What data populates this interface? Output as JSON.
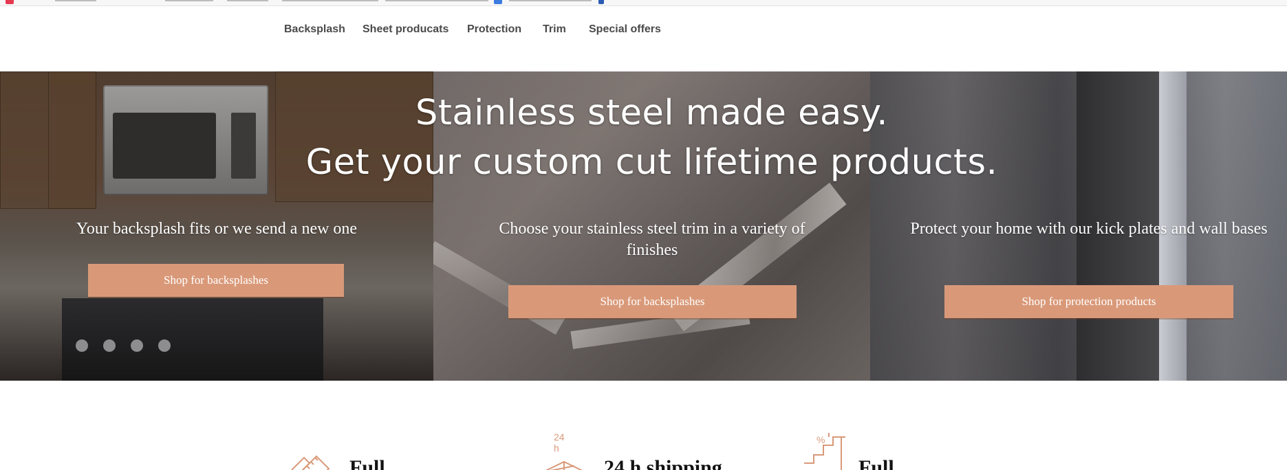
{
  "nav": {
    "items": [
      {
        "label": "Backsplash"
      },
      {
        "label": "Sheet producats"
      },
      {
        "label": "Protection"
      },
      {
        "label": "Trim"
      },
      {
        "label": "Special offers"
      }
    ]
  },
  "hero": {
    "title_line1": "Stainless steel made easy.",
    "title_line2": "Get your custom cut lifetime products.",
    "columns": [
      {
        "text": "Your backsplash fits or we send a new one",
        "button": "Shop for backsplashes"
      },
      {
        "text": "Choose your stainless steel trim in a variety of finishes",
        "button": "Shop for backsplashes"
      },
      {
        "text": "Protect your home with our kick plates and wall bases",
        "button": "Shop for protection products"
      }
    ],
    "button_color": "#d99979"
  },
  "features": [
    {
      "icon": "ruler-pencil-icon",
      "title": "Full"
    },
    {
      "icon": "24h-shipping-box-icon",
      "icon_label": "24 h",
      "title": "24 h shipping"
    },
    {
      "icon": "discount-stairs-icon",
      "icon_label": "%",
      "title": "Full"
    }
  ],
  "accent_color": "#d99979"
}
